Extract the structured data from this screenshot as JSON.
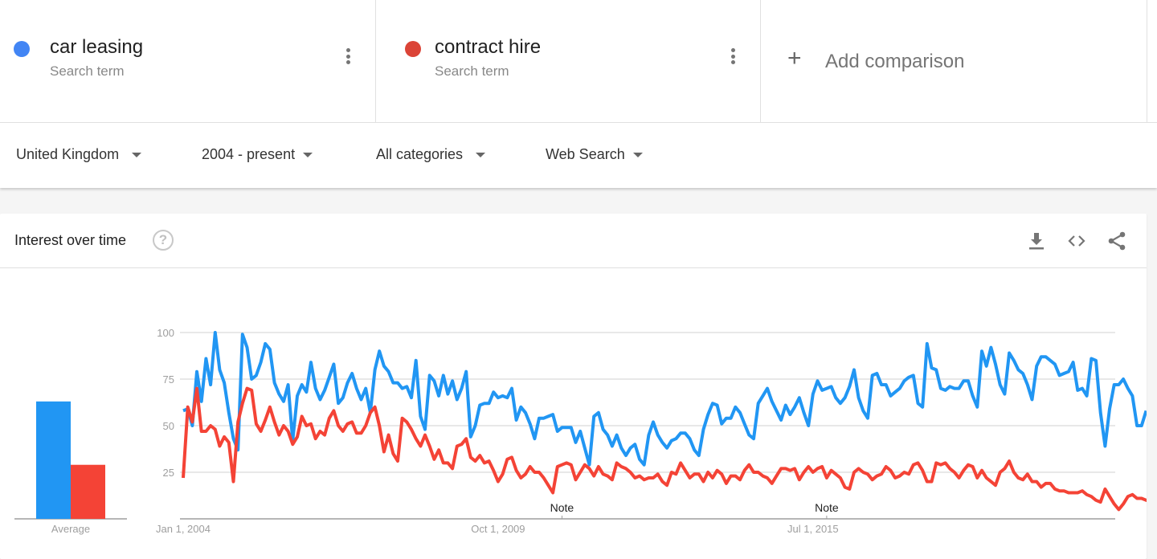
{
  "terms": [
    {
      "name": "car leasing",
      "subtitle": "Search term",
      "color": "#4285f4"
    },
    {
      "name": "contract hire",
      "subtitle": "Search term",
      "color": "#db4437"
    }
  ],
  "add_comparison": {
    "icon": "plus-icon",
    "label": "Add comparison"
  },
  "filters": [
    {
      "label": "United Kingdom"
    },
    {
      "label": "2004 - present"
    },
    {
      "label": "All categories"
    },
    {
      "label": "Web Search"
    }
  ],
  "card": {
    "title": "Interest over time",
    "help_icon": "?",
    "tools": [
      "download-icon",
      "embed-code-icon",
      "share-icon"
    ]
  },
  "chart_data": {
    "type": "line",
    "title": "Interest over time",
    "average_label": "Average",
    "averages": [
      {
        "name": "car leasing",
        "value": 63,
        "color": "#2196f3"
      },
      {
        "name": "contract hire",
        "value": 29,
        "color": "#f44336"
      }
    ],
    "yticks": [
      25,
      50,
      75,
      100
    ],
    "ylim": [
      0,
      100
    ],
    "xtick_labels": [
      {
        "label": "Jan 1, 2004",
        "month_index": 0
      },
      {
        "label": "Oct 1, 2009",
        "month_index": 69
      },
      {
        "label": "Jul 1, 2015",
        "month_index": 138
      }
    ],
    "notes": [
      {
        "label": "Note",
        "month_index": 83
      },
      {
        "label": "Note",
        "month_index": 141
      }
    ],
    "grid": true,
    "x_start": "Jan 2004",
    "x_step": "month",
    "series": [
      {
        "name": "car leasing",
        "color": "#2196f3",
        "values": [
          58,
          59,
          50,
          79,
          63,
          86,
          72,
          100,
          80,
          73,
          57,
          43,
          37,
          99,
          92,
          75,
          77,
          84,
          94,
          91,
          73,
          67,
          63,
          72,
          42,
          66,
          72,
          68,
          84,
          70,
          64,
          69,
          76,
          83,
          62,
          65,
          73,
          78,
          70,
          64,
          70,
          57,
          80,
          90,
          82,
          79,
          73,
          73,
          70,
          71,
          65,
          85,
          55,
          48,
          77,
          74,
          66,
          77,
          67,
          74,
          64,
          70,
          79,
          44,
          50,
          61,
          62,
          62,
          68,
          65,
          66,
          65,
          70,
          53,
          60,
          57,
          51,
          43,
          54,
          54,
          55,
          56,
          47,
          49,
          49,
          49,
          41,
          47,
          38,
          29,
          55,
          57,
          48,
          45,
          39,
          45,
          38,
          34,
          38,
          40,
          32,
          29,
          45,
          52,
          45,
          41,
          38,
          42,
          43,
          46,
          46,
          43,
          37,
          34,
          48,
          56,
          62,
          61,
          51,
          54,
          54,
          60,
          57,
          51,
          45,
          43,
          62,
          66,
          70,
          63,
          58,
          53,
          61,
          56,
          60,
          65,
          57,
          50,
          67,
          74,
          69,
          70,
          71,
          65,
          62,
          65,
          71,
          80,
          65,
          58,
          54,
          77,
          78,
          72,
          72,
          66,
          68,
          70,
          74,
          76,
          77,
          62,
          60,
          94,
          81,
          80,
          70,
          69,
          71,
          70,
          70,
          74,
          74,
          66,
          60,
          90,
          82,
          92,
          83,
          72,
          67,
          89,
          85,
          80,
          78,
          72,
          64,
          82,
          87,
          87,
          85,
          83,
          77,
          78,
          79,
          84,
          69,
          70,
          66,
          86,
          85,
          57,
          39,
          59,
          72,
          72,
          75,
          70,
          66,
          50,
          50,
          58
        ]
      },
      {
        "name": "contract hire",
        "color": "#f44336",
        "values": [
          22,
          60,
          52,
          70,
          47,
          47,
          50,
          48,
          39,
          44,
          41,
          20,
          52,
          62,
          70,
          69,
          51,
          47,
          53,
          60,
          52,
          45,
          50,
          47,
          40,
          44,
          55,
          50,
          51,
          43,
          47,
          45,
          54,
          58,
          50,
          47,
          51,
          52,
          46,
          46,
          50,
          57,
          60,
          50,
          36,
          45,
          35,
          31,
          54,
          52,
          48,
          43,
          39,
          45,
          39,
          32,
          37,
          30,
          30,
          27,
          39,
          40,
          43,
          33,
          31,
          34,
          30,
          31,
          26,
          20,
          24,
          32,
          33,
          26,
          22,
          24,
          28,
          25,
          25,
          22,
          18,
          14,
          28,
          29,
          30,
          29,
          21,
          25,
          29,
          27,
          23,
          28,
          24,
          23,
          21,
          30,
          28,
          27,
          25,
          22,
          23,
          21,
          22,
          22,
          24,
          20,
          18,
          25,
          24,
          30,
          26,
          22,
          24,
          24,
          20,
          25,
          22,
          26,
          24,
          19,
          23,
          23,
          21,
          26,
          29,
          25,
          25,
          23,
          22,
          19,
          23,
          27,
          27,
          26,
          27,
          21,
          25,
          28,
          25,
          27,
          28,
          22,
          26,
          24,
          22,
          17,
          16,
          25,
          27,
          25,
          24,
          21,
          23,
          24,
          28,
          26,
          22,
          23,
          25,
          24,
          29,
          30,
          26,
          20,
          20,
          30,
          29,
          30,
          27,
          25,
          22,
          26,
          29,
          28,
          22,
          26,
          22,
          20,
          18,
          25,
          27,
          31,
          25,
          22,
          21,
          24,
          20,
          20,
          17,
          19,
          19,
          16,
          15,
          15,
          14,
          14,
          14,
          15,
          13,
          12,
          10,
          9,
          16,
          12,
          8,
          5,
          8,
          12,
          13,
          11,
          11,
          10,
          9,
          10
        ]
      }
    ]
  }
}
